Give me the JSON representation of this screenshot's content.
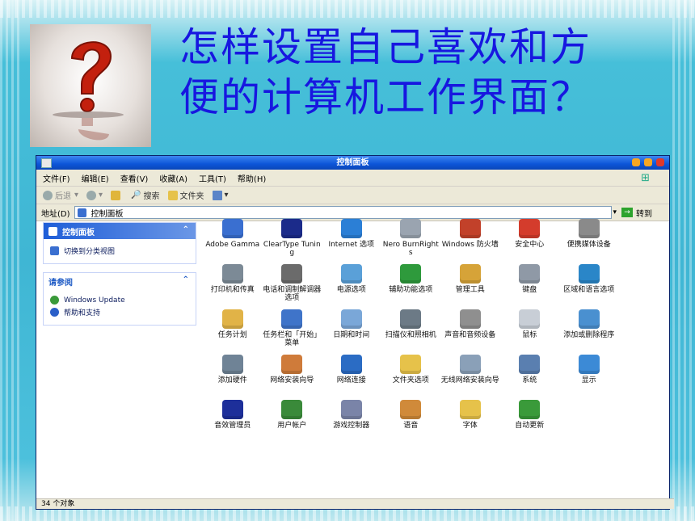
{
  "headline": {
    "line1": "怎样设置自己喜欢和方",
    "line2": "便的计算机工作界面？"
  },
  "window": {
    "title": "控制面板"
  },
  "menu": [
    "文件(F)",
    "编辑(E)",
    "查看(V)",
    "收藏(A)",
    "工具(T)",
    "帮助(H)"
  ],
  "toolbar": {
    "back": "后退",
    "search": "搜索",
    "folders": "文件夹"
  },
  "address": {
    "label": "地址(D)",
    "value": "控制面板",
    "go": "转到"
  },
  "sidebar": {
    "panel1": {
      "title": "控制面板",
      "link": "切换到分类视图"
    },
    "panel2": {
      "title": "请参阅",
      "links": [
        "Windows Update",
        "帮助和支持"
      ]
    }
  },
  "items": [
    {
      "label": "Adobe Gamma",
      "icon": "monitor-icon",
      "color": "#3a6fd0"
    },
    {
      "label": "ClearType Tuning",
      "icon": "cleartype-icon",
      "color": "#1b2b8a"
    },
    {
      "label": "Internet 选项",
      "icon": "globe-icon",
      "color": "#2b7fd6"
    },
    {
      "label": "Nero BurnRights",
      "icon": "disc-icon",
      "color": "#9aa4b0"
    },
    {
      "label": "Windows 防火墙",
      "icon": "firewall-icon",
      "color": "#c2412a"
    },
    {
      "label": "安全中心",
      "icon": "shield-icon",
      "color": "#d43c2c"
    },
    {
      "label": "便携媒体设备",
      "icon": "media-device-icon",
      "color": "#8a8a8a"
    },
    {
      "label": "打印机和传真",
      "icon": "printer-icon",
      "color": "#7c8a96"
    },
    {
      "label": "电话和调制解调器选项",
      "icon": "phone-icon",
      "color": "#6b6b6b"
    },
    {
      "label": "电源选项",
      "icon": "power-icon",
      "color": "#5aa0d8"
    },
    {
      "label": "辅助功能选项",
      "icon": "accessibility-icon",
      "color": "#2e9a3c"
    },
    {
      "label": "管理工具",
      "icon": "admin-tools-icon",
      "color": "#d6a338"
    },
    {
      "label": "键盘",
      "icon": "keyboard-icon",
      "color": "#8f99a6"
    },
    {
      "label": "区域和语言选项",
      "icon": "region-icon",
      "color": "#2a86c8"
    },
    {
      "label": "任务计划",
      "icon": "scheduled-tasks-icon",
      "color": "#e1b347"
    },
    {
      "label": "任务栏和「开始」菜单",
      "icon": "taskbar-icon",
      "color": "#3f74c9"
    },
    {
      "label": "日期和时间",
      "icon": "clock-icon",
      "color": "#7aa7d8"
    },
    {
      "label": "扫描仪和照相机",
      "icon": "scanner-icon",
      "color": "#6c7a86"
    },
    {
      "label": "声音和音频设备",
      "icon": "speaker-icon",
      "color": "#8f8f8f"
    },
    {
      "label": "鼠标",
      "icon": "mouse-icon",
      "color": "#c8ced6"
    },
    {
      "label": "添加或删除程序",
      "icon": "add-remove-icon",
      "color": "#4a90d0"
    },
    {
      "label": "添加硬件",
      "icon": "hardware-icon",
      "color": "#6f8396"
    },
    {
      "label": "网络安装向导",
      "icon": "network-wizard-icon",
      "color": "#cf7b3a"
    },
    {
      "label": "网络连接",
      "icon": "network-icon",
      "color": "#2b6cc4"
    },
    {
      "label": "文件夹选项",
      "icon": "folder-options-icon",
      "color": "#e6c24a"
    },
    {
      "label": "无线网络安装向导",
      "icon": "wireless-icon",
      "color": "#8aa0b8"
    },
    {
      "label": "系统",
      "icon": "system-icon",
      "color": "#5a7fb0"
    },
    {
      "label": "显示",
      "icon": "display-icon",
      "color": "#3c8ad6"
    },
    {
      "label": "音效管理员",
      "icon": "audio-manager-icon",
      "color": "#1d2f9a"
    },
    {
      "label": "用户帐户",
      "icon": "users-icon",
      "color": "#3a8a3a"
    },
    {
      "label": "游戏控制器",
      "icon": "gamepad-icon",
      "color": "#7a84a8"
    },
    {
      "label": "语音",
      "icon": "speech-icon",
      "color": "#d08a3a"
    },
    {
      "label": "字体",
      "icon": "fonts-icon",
      "color": "#e6c24a"
    },
    {
      "label": "自动更新",
      "icon": "auto-update-icon",
      "color": "#3a9a3a"
    }
  ],
  "status": "34 个对象"
}
